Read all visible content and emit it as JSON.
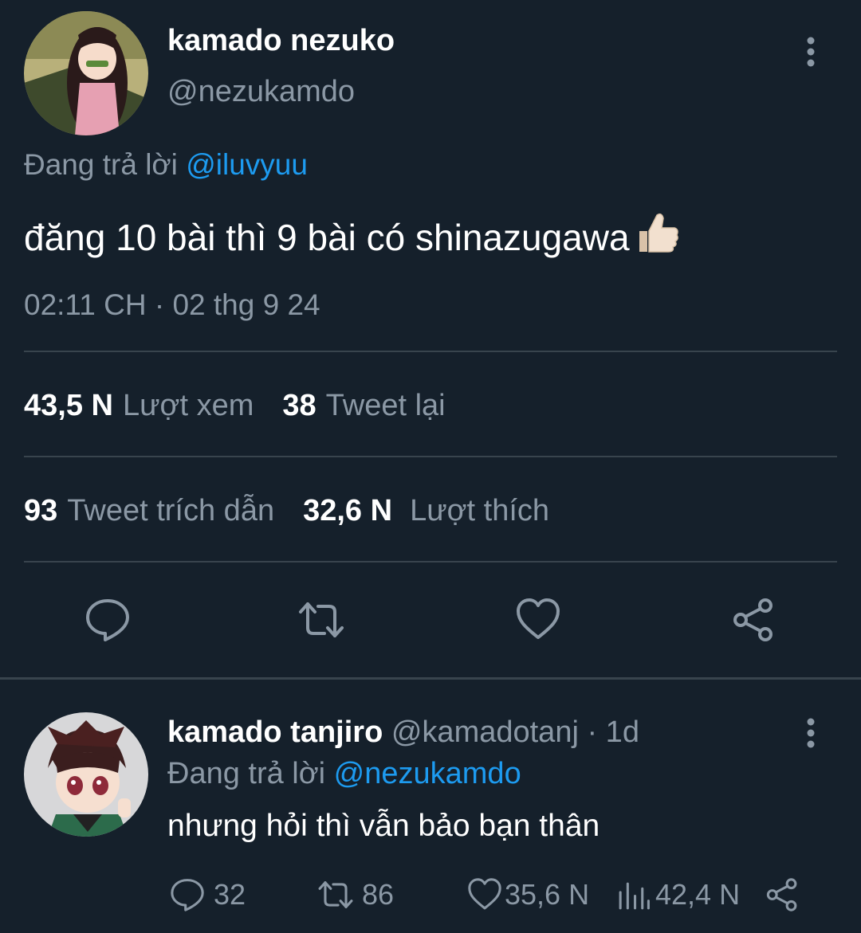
{
  "tweet": {
    "display_name": "kamado nezuko",
    "handle": "@nezukamdo",
    "reply_prefix": "Đang trả lời",
    "reply_to": "@iluvyuu",
    "text": "đăng 10 bài thì 9 bài có shinazugawa",
    "emoji": "thumbs-up",
    "timestamp": "02:11 CH · 02 thg 9 24",
    "stats": {
      "views_count": "43,5 N",
      "views_label": "Lượt xem",
      "retweets_count": "38",
      "retweets_label": "Tweet lại",
      "quotes_count": "93",
      "quotes_label": "Tweet trích dẫn",
      "likes_count": "32,6 N",
      "likes_label": "Lượt thích"
    },
    "actions": [
      "reply-icon",
      "retweet-icon",
      "like-icon",
      "share-icon"
    ]
  },
  "reply": {
    "display_name": "kamado tanjiro",
    "handle": "@kamadotanj",
    "age": "· 1d",
    "reply_prefix": "Đang trả lời",
    "reply_to": "@nezukamdo",
    "text": "nhưng hỏi thì vẫn bảo bạn thân",
    "counts": {
      "replies": "32",
      "retweets": "86",
      "likes": "35,6 N",
      "views": "42,4 N"
    }
  },
  "colors": {
    "background": "#15202b",
    "text": "#ffffff",
    "muted": "#8b98a5",
    "link": "#1d9bf0",
    "divider": "#38444d"
  }
}
